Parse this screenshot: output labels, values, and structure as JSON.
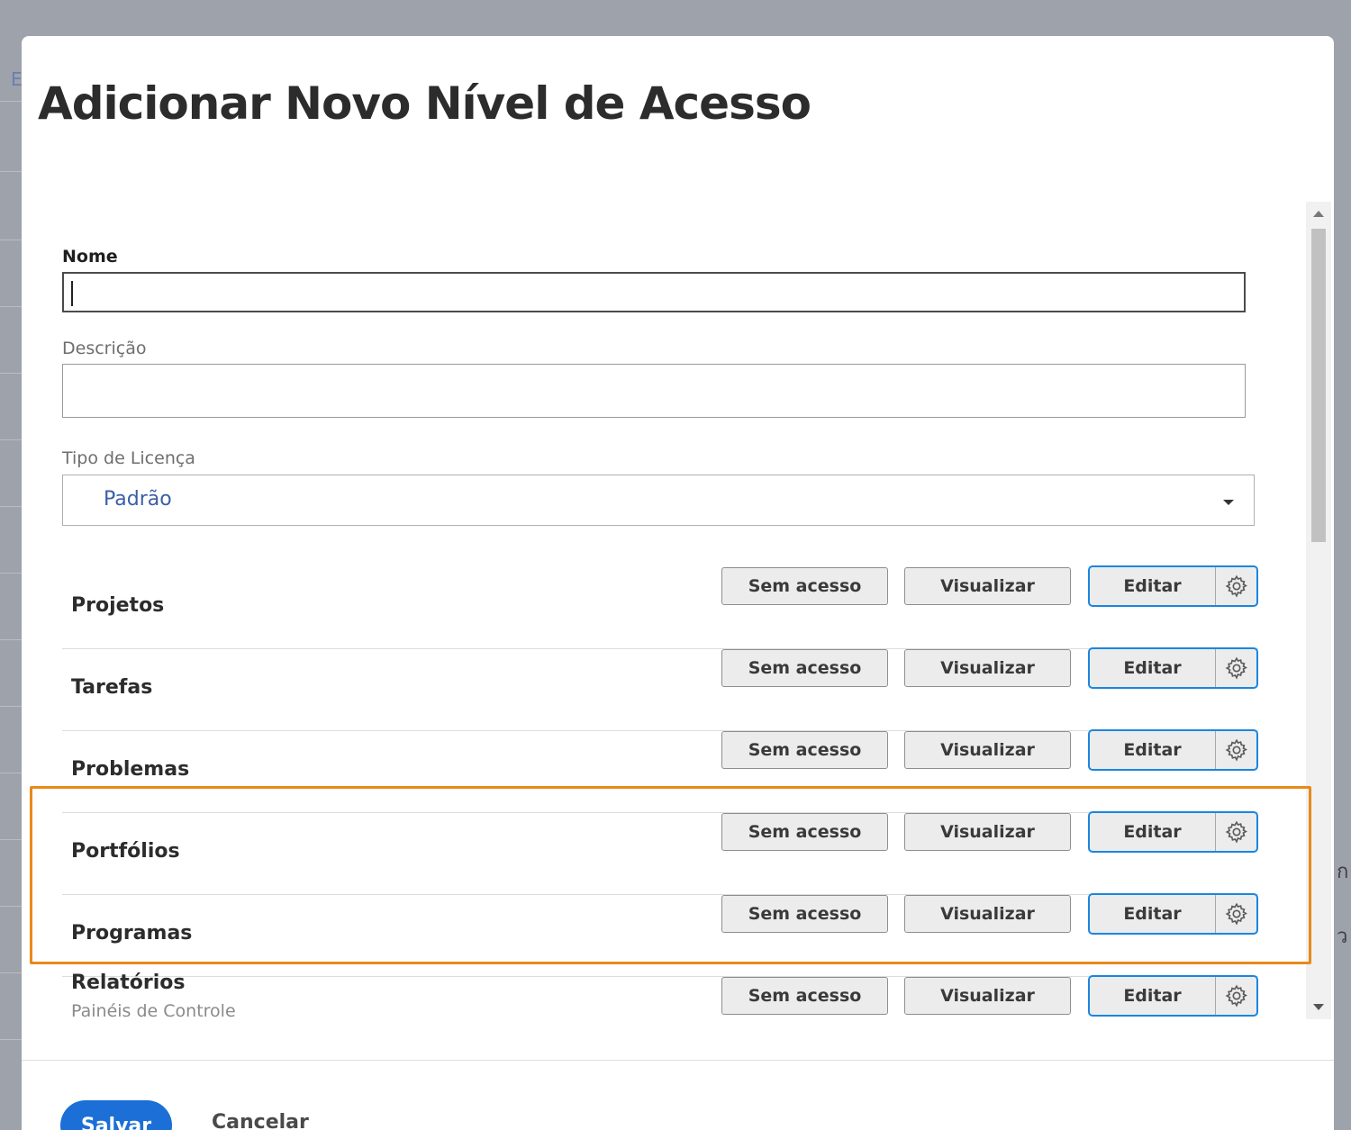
{
  "modal": {
    "title": "Adicionar Novo Nível de Acesso"
  },
  "form": {
    "name": {
      "label": "Nome",
      "value": "",
      "placeholder": ""
    },
    "description": {
      "label": "Descrição",
      "value": "",
      "placeholder": ""
    },
    "license": {
      "label": "Tipo de Licença",
      "selected": "Padrão"
    }
  },
  "access_rows": [
    {
      "label": "Projetos",
      "none": "Sem acesso",
      "view": "Visualizar",
      "edit": "Editar"
    },
    {
      "label": "Tarefas",
      "none": "Sem acesso",
      "view": "Visualizar",
      "edit": "Editar"
    },
    {
      "label": "Problemas",
      "none": "Sem acesso",
      "view": "Visualizar",
      "edit": "Editar"
    },
    {
      "label": "Portfólios",
      "none": "Sem acesso",
      "view": "Visualizar",
      "edit": "Editar"
    },
    {
      "label": "Programas",
      "none": "Sem acesso",
      "view": "Visualizar",
      "edit": "Editar"
    },
    {
      "label": "Relatórios",
      "sublabel": "Painéis de Controle",
      "none": "Sem acesso",
      "view": "Visualizar",
      "edit": "Editar"
    }
  ],
  "footer": {
    "save": "Salvar",
    "cancel": "Cancelar"
  },
  "background": {
    "letter": "E"
  },
  "colors": {
    "accent_blue": "#1a86e0",
    "save_blue": "#1b6fd6",
    "highlight_orange": "#e8891a"
  }
}
